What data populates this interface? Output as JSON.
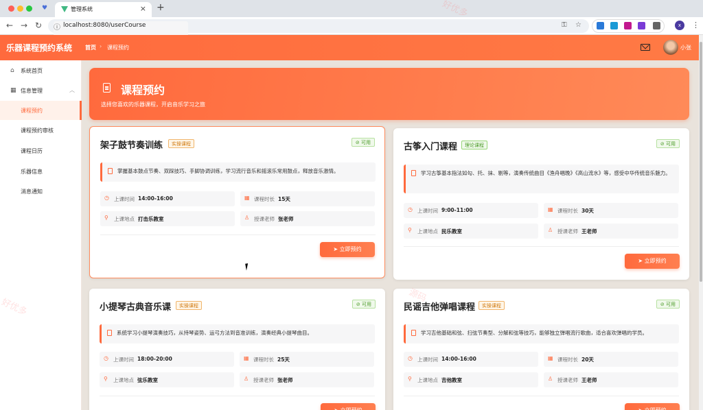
{
  "browser": {
    "tab_title": "管理系统",
    "url": "localhost:8080/userCourse"
  },
  "app": {
    "brand": "乐器课程预约系统",
    "breadcrumb_home": "首页",
    "breadcrumb_current": "课程预约",
    "username": "小张"
  },
  "sidebar": {
    "home": "系统首页",
    "group": "信息管理",
    "items": [
      {
        "label": "课程预约"
      },
      {
        "label": "课程预约审核"
      },
      {
        "label": "课程日历"
      },
      {
        "label": "乐器信息"
      },
      {
        "label": "消息通知"
      }
    ]
  },
  "banner": {
    "title": "课程预约",
    "subtitle": "选择您喜欢的乐器课程，开启音乐学习之旅"
  },
  "labels": {
    "time": "上课时间",
    "duration": "课程时长",
    "location": "上课地点",
    "teacher": "授课老师",
    "available": "可用",
    "book": "立即预约"
  },
  "courses": [
    {
      "title": "架子鼓节奏训练",
      "tag": "实操课程",
      "desc": "掌握基本鼓点节奏、双踩技巧、手脚协调训练，学习流行音乐和摇滚乐常用鼓点，释放音乐激情。",
      "time": "14:00-16:00",
      "duration": "15天",
      "location": "打击乐教室",
      "teacher": "张老师"
    },
    {
      "title": "古筝入门课程",
      "tag": "理论课程",
      "desc": "学习古筝基本指法如勾、托、抹、剔等，演奏传统曲目《渔舟唱晚》《高山流水》等，感受中华传统音乐魅力。",
      "time": "9:00-11:00",
      "duration": "30天",
      "location": "民乐教室",
      "teacher": "王老师"
    },
    {
      "title": "小提琴古典音乐课",
      "tag": "实操课程",
      "desc": "系统学习小提琴演奏技巧，从持琴姿势、运弓方法到音准训练，演奏经典小提琴曲目。",
      "time": "18:00-20:00",
      "duration": "25天",
      "location": "弦乐教室",
      "teacher": "张老师"
    },
    {
      "title": "民谣吉他弹唱课程",
      "tag": "实操课程",
      "desc": "学习吉他基础和弦、扫弦节奏型、分解和弦等技巧，能够独立弹唱流行歌曲，适合喜欢弹唱的学员。",
      "time": "14:00-16:00",
      "duration": "20天",
      "location": "吉他教室",
      "teacher": "王老师"
    }
  ],
  "watermarks": [
    "好优多",
    "好优多",
    "源码"
  ],
  "colors": {
    "accent": "#ff6a3d",
    "available": "#4b9b28"
  }
}
